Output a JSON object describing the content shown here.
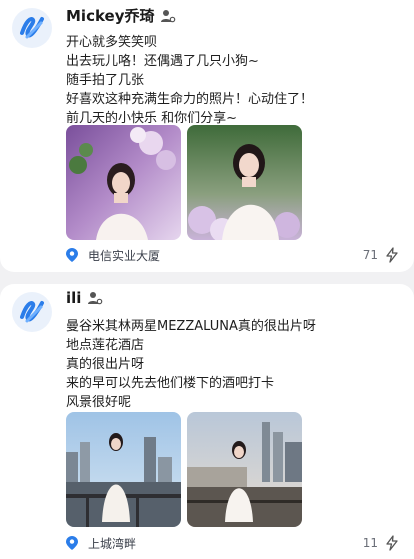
{
  "posts": [
    {
      "username": "Mickey乔琦",
      "lines": [
        "开心就多笑笑呗",
        "出去玩儿咯！还偶遇了几只小狗~",
        "随手拍了几张",
        "好喜欢这种充满生命力的照片！心动住了！",
        "前几天的小快乐 和你们分享~"
      ],
      "location": "电信实业大厦",
      "count": "71"
    },
    {
      "username": "ili",
      "lines": [
        "曼谷米其林两星MEZZALUNA真的很出片呀",
        "地点莲花酒店",
        "真的很出片呀",
        "来的早可以先去他们楼下的酒吧打卡",
        "风景很好呢"
      ],
      "location": "上城湾畔",
      "count": "11"
    }
  ],
  "colors": {
    "accent": "#2b7de9",
    "avatar_bg": "#eaf1fb",
    "page_bg": "#f1f1f3"
  },
  "icons": {
    "avatar": "scribble-logo-icon",
    "user_badge": "user-badge-icon",
    "location": "location-pin-icon",
    "share": "lightning-share-icon"
  }
}
